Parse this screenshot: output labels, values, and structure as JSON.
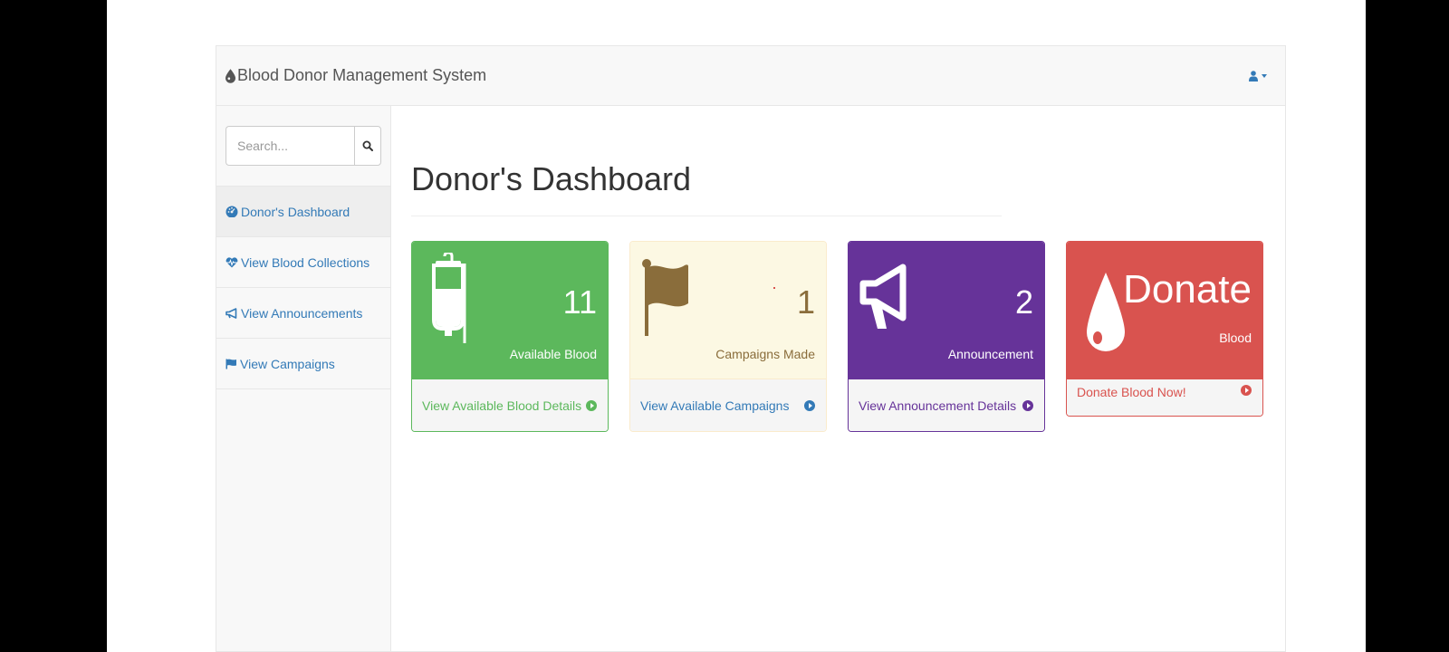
{
  "navbar": {
    "brand": "Blood Donor Management System"
  },
  "sidebar": {
    "search": {
      "placeholder": "Search...",
      "value": ""
    },
    "items": [
      {
        "label": "Donor's Dashboard",
        "icon": "dashboard-icon",
        "active": true
      },
      {
        "label": "View Blood Collections",
        "icon": "heartbeat-icon"
      },
      {
        "label": "View Announcements",
        "icon": "bullhorn-icon"
      },
      {
        "label": "View Campaigns",
        "icon": "flag-icon"
      }
    ]
  },
  "main": {
    "title": "Donor's Dashboard",
    "panels": [
      {
        "number": "11",
        "label": "Available Blood",
        "link": "View Available Blood Details",
        "icon": "blood-bag-icon",
        "color": "#5cb85c"
      },
      {
        "number": "1",
        "label": "Campaigns Made",
        "link": "View Available Campaigns",
        "icon": "flag-icon",
        "color": "#8a6d3b"
      },
      {
        "number": "2",
        "label": "Announcement",
        "link": "View Announcement Details",
        "icon": "bullhorn-icon",
        "color": "#663399"
      },
      {
        "number": "Donate",
        "label": "Blood",
        "link": "Donate Blood Now!",
        "icon": "blood-drop-icon",
        "color": "#d9534f"
      }
    ]
  },
  "colors": {
    "link": "#337ab7",
    "green": "#5cb85c",
    "cream": "#fcf8e3",
    "purple": "#663399",
    "red": "#d9534f"
  }
}
